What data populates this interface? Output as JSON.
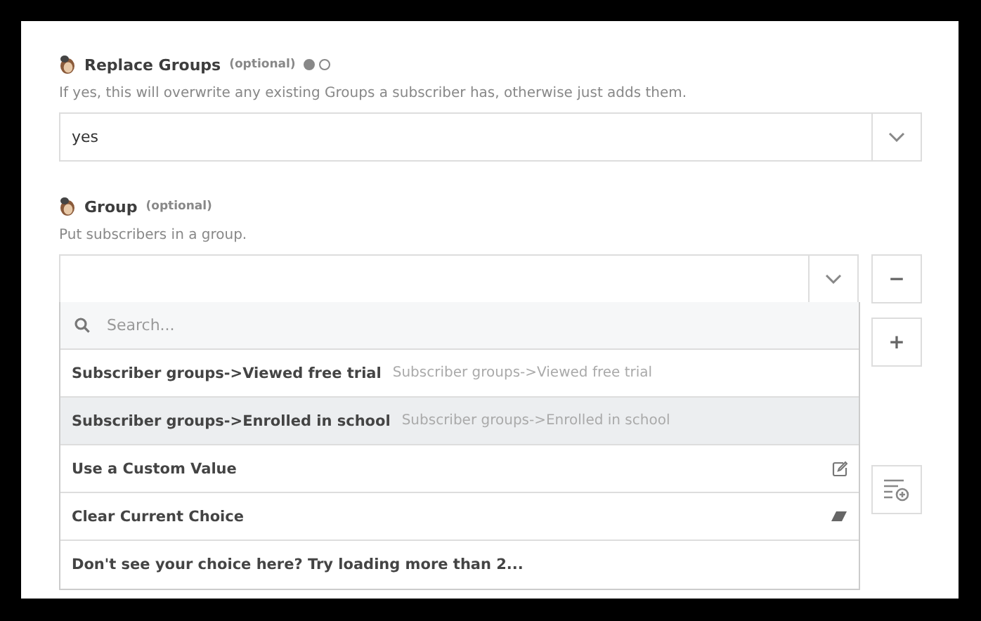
{
  "fields": [
    {
      "label": "Replace Groups",
      "optional": "(optional)",
      "toggle": [
        {
          "selected": true
        },
        {
          "selected": false
        }
      ],
      "description": "If yes, this will overwrite any existing Groups a subscriber has, otherwise just adds them.",
      "value": "yes"
    },
    {
      "label": "Group",
      "optional": "(optional)",
      "description": "Put subscribers in a group."
    }
  ],
  "dropdown": {
    "search_placeholder": "Search...",
    "items": [
      {
        "kind": "option",
        "label": "Subscriber groups->Viewed free trial",
        "hint": "Subscriber groups->Viewed free trial",
        "selected": false
      },
      {
        "kind": "option",
        "label": "Subscriber groups->Enrolled in school",
        "hint": "Subscriber groups->Enrolled in school",
        "selected": true
      },
      {
        "kind": "custom",
        "label": "Use a Custom Value",
        "selected": false
      },
      {
        "kind": "clear",
        "label": "Clear Current Choice",
        "selected": false
      },
      {
        "kind": "more",
        "label": "Don't see your choice here? Try loading more than 2...",
        "selected": false
      }
    ]
  },
  "side_buttons": [
    {
      "kind": "minus",
      "label": "−"
    },
    {
      "kind": "plus",
      "label": "+"
    },
    {
      "kind": "list"
    }
  ]
}
